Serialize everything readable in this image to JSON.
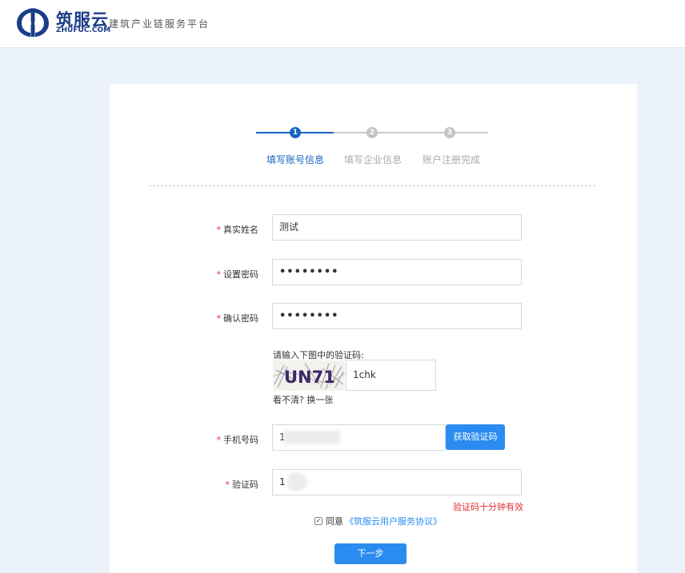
{
  "header": {
    "logo_name": "筑服云",
    "logo_sub": "ZHUFUC.COM",
    "slogan": "建筑产业链服务平台"
  },
  "steps": [
    {
      "num": "1",
      "label": "填写账号信息",
      "state": "active"
    },
    {
      "num": "2",
      "label": "填写企业信息",
      "state": "pending"
    },
    {
      "num": "3",
      "label": "账户注册完成",
      "state": "pending"
    }
  ],
  "colors": {
    "accent": "#2a8cf0",
    "step_active": "#1565c0",
    "step_pending": "#cccccc",
    "required": "#e23030"
  },
  "form": {
    "required_mark": "*",
    "name": {
      "label": "真实姓名",
      "value": "测试"
    },
    "password": {
      "label": "设置密码",
      "value": "••••••••"
    },
    "confirm": {
      "label": "确认密码",
      "value": "••••••••"
    },
    "captcha": {
      "tip": "请输入下图中的验证码:",
      "image_text": "UN71",
      "value": "1chk",
      "refresh": "看不清? 换一张"
    },
    "phone": {
      "label": "手机号码",
      "value": "1",
      "button": "获取验证码"
    },
    "sms_code": {
      "label": "验证码",
      "value": "1",
      "note": "验证码十分钟有效"
    },
    "agreement": {
      "checked_mark": "✓",
      "prefix": "同意",
      "link": "《筑服云用户服务协议》"
    },
    "next_button": "下一步"
  }
}
